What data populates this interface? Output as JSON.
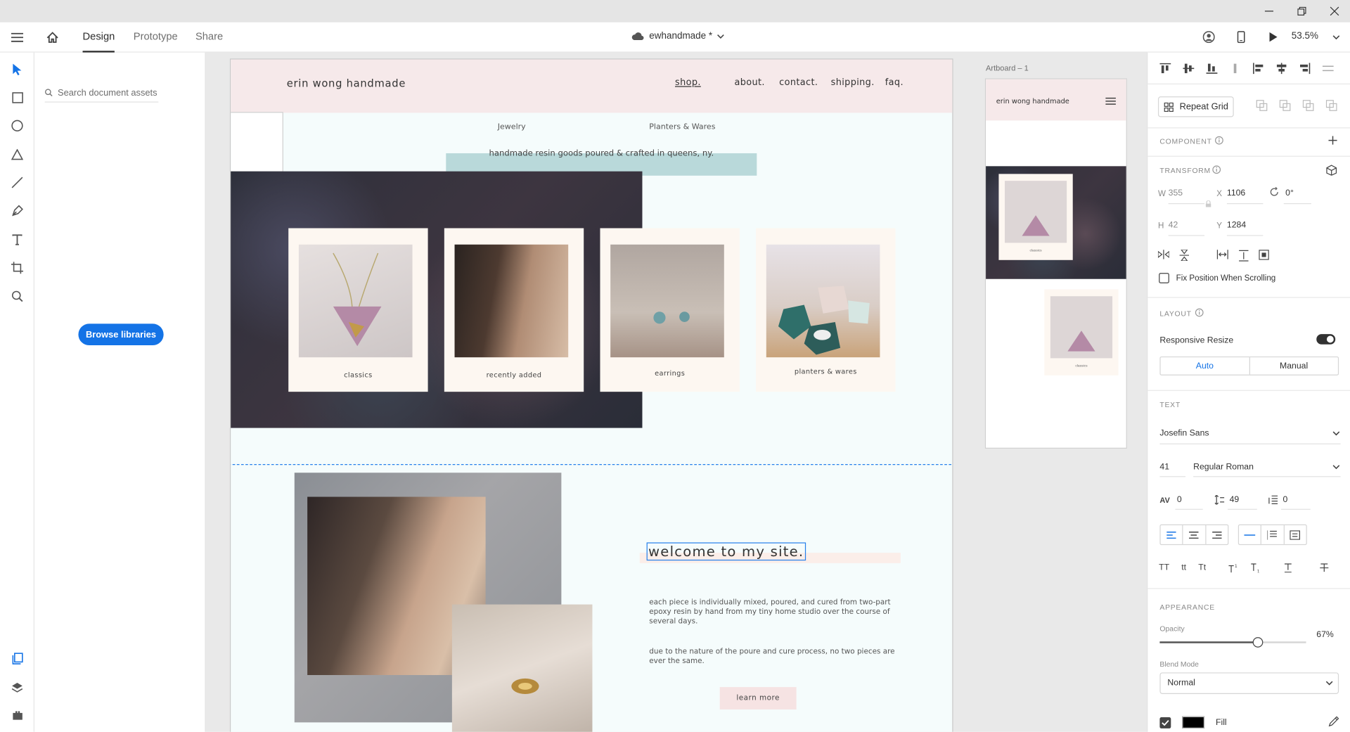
{
  "app": {
    "tabs": [
      "Design",
      "Prototype",
      "Share"
    ],
    "document_title": "ewhandmade *",
    "zoom": "53.5%"
  },
  "assets": {
    "search_placeholder": "Search document assets",
    "browse_label": "Browse libraries"
  },
  "artboard": {
    "brand": "erin wong handmade",
    "nav": [
      "shop.",
      "about.",
      "contact.",
      "shipping.",
      "faq."
    ],
    "subnav": [
      "Jewelry",
      "Planters & Wares"
    ],
    "tagline": "handmade resin goods poured & crafted in queens, ny.",
    "cards": [
      "classics",
      "recently added",
      "earrings",
      "planters & wares"
    ],
    "welcome": "welcome to my site.",
    "para1": "each piece is individually mixed, poured, and cured from two-part epoxy resin by hand from my tiny home studio over the course of several days.",
    "para2": "due to the nature of the poure and cure process, no two pieces are ever the same.",
    "learn_more": "learn more"
  },
  "mobile": {
    "label": "Artboard – 1",
    "brand": "erin wong handmade",
    "card_caption": "classics",
    "card_caption_2": "classics"
  },
  "inspector": {
    "repeat_grid": "Repeat Grid",
    "component": "COMPONENT",
    "transform": "TRANSFORM",
    "w_label": "W",
    "w": "355",
    "x_label": "X",
    "x": "1106",
    "rotation": "0°",
    "h_label": "H",
    "h": "42",
    "y_label": "Y",
    "y": "1284",
    "fix_position": "Fix Position When Scrolling",
    "layout": "LAYOUT",
    "responsive_resize": "Responsive Resize",
    "auto": "Auto",
    "manual": "Manual",
    "text": "TEXT",
    "font": "Josefin Sans",
    "font_size": "41",
    "font_style": "Regular Roman",
    "char_spacing": "0",
    "line_spacing": "49",
    "para_spacing": "0",
    "case_buttons": [
      "TT",
      "tt",
      "Tt"
    ],
    "appearance": "APPEARANCE",
    "opacity_label": "Opacity",
    "opacity": "67%",
    "opacity_fraction": 0.67,
    "blend_label": "Blend Mode",
    "blend": "Normal",
    "fill": "Fill"
  },
  "colors": {
    "accent": "#1473e6",
    "header_pink": "#f6e9ea",
    "tag_teal": "#b9d9da"
  }
}
